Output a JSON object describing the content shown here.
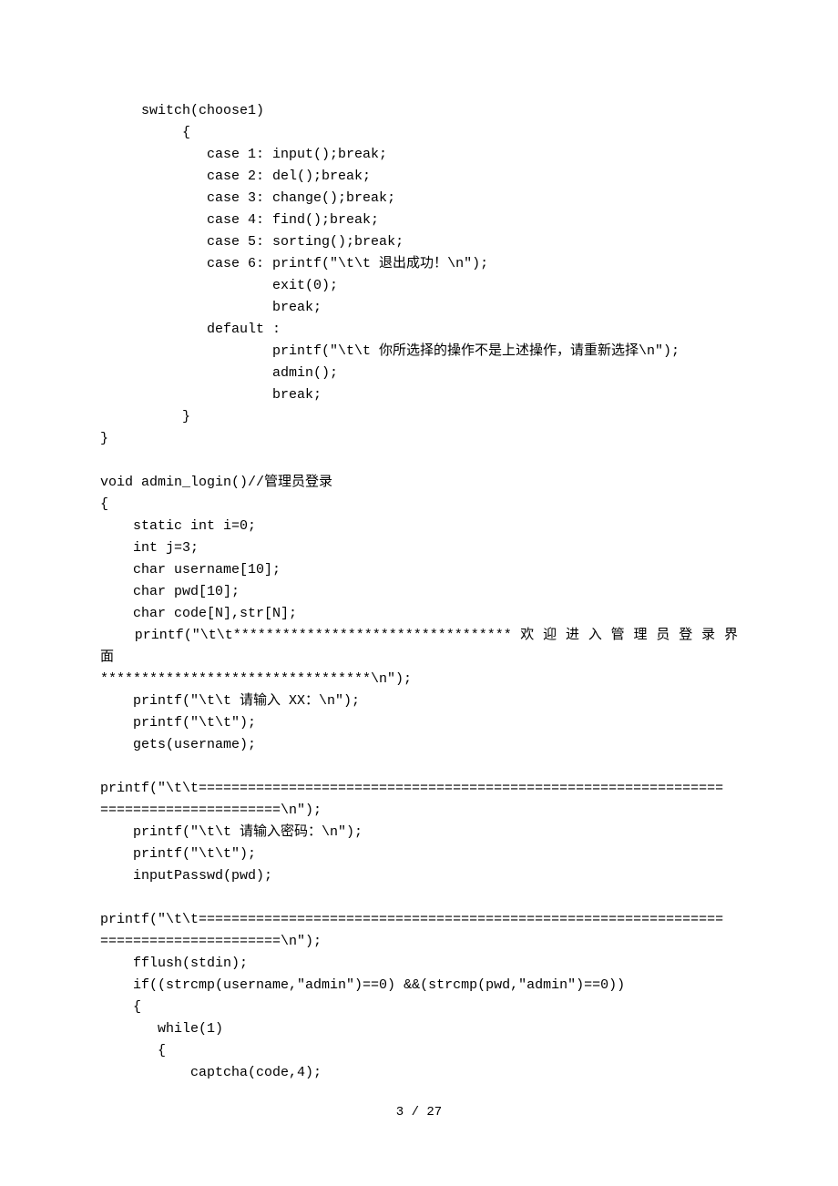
{
  "lines": {
    "l1": "     switch(choose1)",
    "l2": "          {",
    "l3": "             case 1: input();break;",
    "l4": "             case 2: del();break;",
    "l5": "             case 3: change();break;",
    "l6": "             case 4: find();break;",
    "l7": "             case 5: sorting();break;",
    "l8": "             case 6: printf(\"\\t\\t 退出成功！\\n\");",
    "l9": "                     exit(0);",
    "l10": "                     break;",
    "l11": "             default :",
    "l12": "                     printf(\"\\t\\t 你所选择的操作不是上述操作，请重新选择\\n\");",
    "l13": "                     admin();",
    "l14": "                     break;",
    "l15": "          }",
    "l16": "}",
    "l17": "",
    "l18": "void admin_login()//管理员登录",
    "l19": "{",
    "l20": "    static int i=0;",
    "l21": "    int j=3;",
    "l22": "    char username[10];",
    "l23": "    char pwd[10];",
    "l24": "    char code[N],str[N];",
    "l25a": "    printf(\"\\t\\t********************************** 欢 迎 进 入 管 理 员 登 录 界 面",
    "l25b": "*********************************\\n\");",
    "l26": "    printf(\"\\t\\t 请输入 XX：\\n\");",
    "l27": "    printf(\"\\t\\t\");",
    "l28": "    gets(username);",
    "l29": "",
    "l30a": "printf(\"\\t\\t================================================================",
    "l30b": "======================\\n\");",
    "l31": "    printf(\"\\t\\t 请输入密码：\\n\");",
    "l32": "    printf(\"\\t\\t\");",
    "l33": "    inputPasswd(pwd);",
    "l34": "",
    "l35a": "printf(\"\\t\\t================================================================",
    "l35b": "======================\\n\");",
    "l36": "    fflush(stdin);",
    "l37": "    if((strcmp(username,\"admin\")==0) &&(strcmp(pwd,\"admin\")==0))",
    "l38": "    {",
    "l39": "       while(1)",
    "l40": "       {",
    "l41": "           captcha(code,4);"
  },
  "footer": "3 / 27"
}
